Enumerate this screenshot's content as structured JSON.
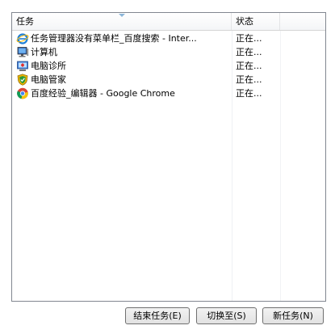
{
  "columns": {
    "task": "任务",
    "status": "状态"
  },
  "tasks": [
    {
      "name": "任务管理器没有菜单栏_百度搜索 - Inter...",
      "status": "正在...",
      "icon": "ie-icon"
    },
    {
      "name": "计算机",
      "status": "正在...",
      "icon": "computer-icon"
    },
    {
      "name": "电脑诊所",
      "status": "正在...",
      "icon": "pc-clinic-icon"
    },
    {
      "name": "电脑管家",
      "status": "正在...",
      "icon": "pc-manager-shield-icon"
    },
    {
      "name": "百度经验_编辑器 - Google Chrome",
      "status": "正在...",
      "icon": "chrome-icon"
    }
  ],
  "buttons": {
    "end_task": "结束任务(E)",
    "switch_to": "切换至(S)",
    "new_task": "新任务(N)"
  }
}
